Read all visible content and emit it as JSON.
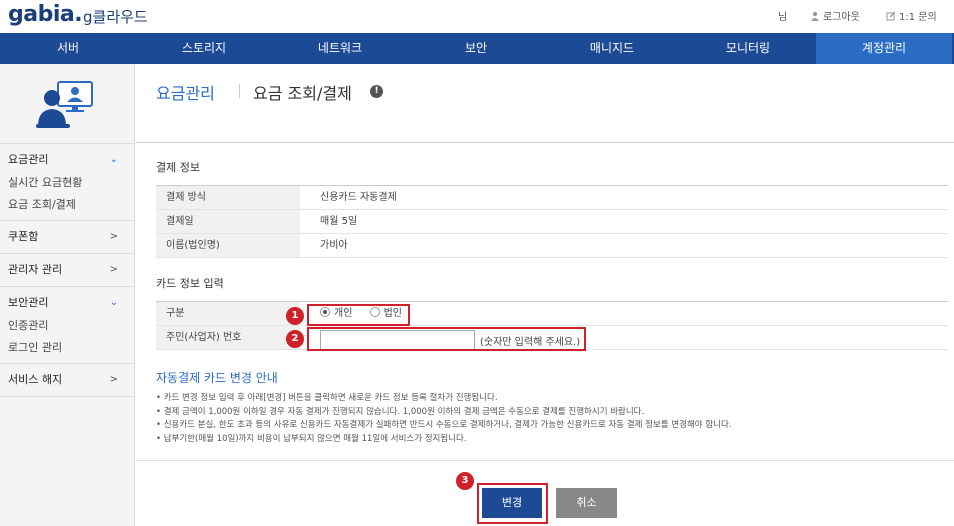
{
  "header": {
    "logo_text": "gabia.",
    "logo_sub": "g클라우드",
    "user_suffix": "님",
    "logout": "로그아웃",
    "inquiry": "1:1 문의"
  },
  "nav": {
    "items": [
      "서버",
      "스토리지",
      "네트워크",
      "보안",
      "매니지드",
      "모니터링",
      "계정관리"
    ],
    "active": "계정관리"
  },
  "sidebar": {
    "sections": [
      {
        "label": "요금관리",
        "expanded": true,
        "children": [
          "실시간 요금현황",
          "요금 조회/결제"
        ]
      },
      {
        "label": "쿠폰함",
        "expanded": false,
        "children": []
      },
      {
        "label": "관리자 관리",
        "expanded": false,
        "children": []
      },
      {
        "label": "보안관리",
        "expanded": true,
        "children": [
          "인증관리",
          "로그인 관리"
        ]
      },
      {
        "label": "서비스 해지",
        "expanded": false,
        "children": []
      }
    ]
  },
  "page": {
    "breadcrumb_parent": "요금관리",
    "title": "요금 조회/결제",
    "info_icon": "!"
  },
  "payment_info": {
    "section_title": "결제 정보",
    "rows": [
      {
        "label": "결제 방식",
        "value": "신용카드 자동결제"
      },
      {
        "label": "결제일",
        "value": "매월 5일"
      },
      {
        "label": "이름(법인명)",
        "value": "가비아"
      }
    ]
  },
  "card_input": {
    "section_title": "카드 정보 입력",
    "type_label": "구분",
    "type_options": [
      "개인",
      "법인"
    ],
    "type_selected": "개인",
    "id_label": "주민(사업자) 번호",
    "id_value": "",
    "id_hint": "(숫자만 입력해 주세요.)"
  },
  "guide": {
    "title": "자동결제 카드 변경 안내",
    "items": [
      "카드 변경 정보 입력 후 아래[변경] 버튼을 클릭하면 새로운 카드 정보 등록 절차가 진행됩니다.",
      "결제 금액이 1,000원 이하일 경우 자동 결제가 진행되지 않습니다. 1,000원 이하의 결제 금액은 수동으로 결제를 진행하시기 바랍니다.",
      "신용카드 분실, 한도 초과 등의 사유로 신용카드 자동결제가 실패하면 반드시 수동으로 결제하거나, 결제가 가능한 신용카드로 자동 결제 정보를 변경해야 합니다.",
      "납부기한(매월 10일)까지 비용이 납부되지 않으면 매월 11일에 서비스가 정지됩니다."
    ]
  },
  "buttons": {
    "change": "변경",
    "cancel": "취소"
  },
  "annotations": [
    "1",
    "2",
    "3"
  ],
  "colors": {
    "nav_bg": "#1d4a94",
    "nav_active": "#2b6cc4",
    "accent": "#2b6cc4",
    "highlight": "#d0202a"
  }
}
